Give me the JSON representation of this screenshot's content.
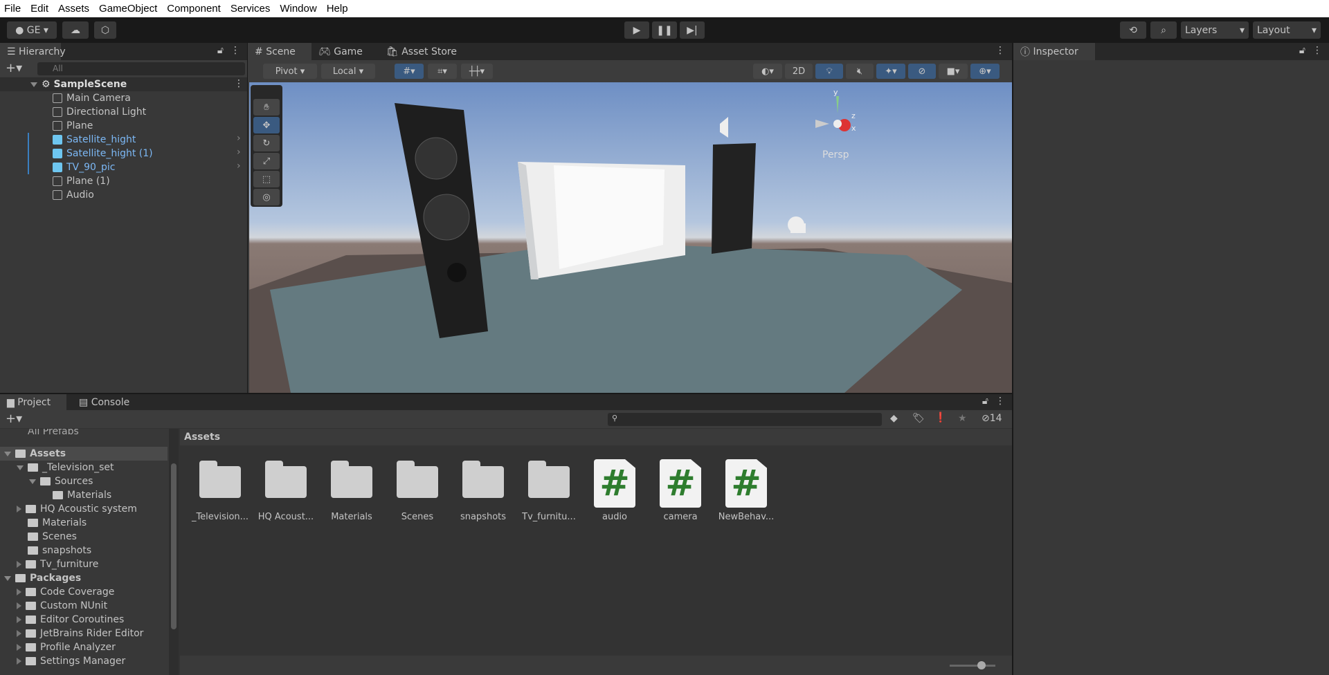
{
  "menu": [
    "File",
    "Edit",
    "Assets",
    "GameObject",
    "Component",
    "Services",
    "Window",
    "Help"
  ],
  "toolbar": {
    "account": "GE",
    "layers": "Layers",
    "layout": "Layout"
  },
  "hierarchy": {
    "title": "Hierarchy",
    "search_placeholder": "All",
    "scene": "SampleScene",
    "items": [
      {
        "label": "Main Camera",
        "prefab": false
      },
      {
        "label": "Directional Light",
        "prefab": false
      },
      {
        "label": "Plane",
        "prefab": false
      },
      {
        "label": "Satellite_hight",
        "prefab": true
      },
      {
        "label": "Satellite_hight (1)",
        "prefab": true
      },
      {
        "label": "TV_90_pic",
        "prefab": true
      },
      {
        "label": "Plane (1)",
        "prefab": false
      },
      {
        "label": "Audio",
        "prefab": false
      }
    ]
  },
  "scene": {
    "tabs": [
      "Scene",
      "Game",
      "Asset Store"
    ],
    "pivot": "Pivot",
    "local": "Local",
    "mode2d": "2D",
    "persp": "Persp",
    "gizmo_axes": {
      "y": "y",
      "z": "z",
      "x": "x"
    }
  },
  "inspector": {
    "title": "Inspector"
  },
  "project": {
    "tabs": [
      "Project",
      "Console"
    ],
    "hidden_count": "14",
    "breadcrumb": "Assets",
    "cut_item": "All Prefabs",
    "tree": [
      {
        "label": "Assets",
        "depth": 0,
        "bold": true,
        "open": true
      },
      {
        "label": "_Television_set",
        "depth": 1,
        "open": true
      },
      {
        "label": "Sources",
        "depth": 2,
        "open": true
      },
      {
        "label": "Materials",
        "depth": 3
      },
      {
        "label": "HQ Acoustic system",
        "depth": 1,
        "closed": true
      },
      {
        "label": "Materials",
        "depth": 1
      },
      {
        "label": "Scenes",
        "depth": 1
      },
      {
        "label": "snapshots",
        "depth": 1
      },
      {
        "label": "Tv_furniture",
        "depth": 1,
        "closed": true
      },
      {
        "label": "Packages",
        "depth": 0,
        "bold": true,
        "open": true
      },
      {
        "label": "Code Coverage",
        "depth": 1,
        "closed": true
      },
      {
        "label": "Custom NUnit",
        "depth": 1,
        "closed": true
      },
      {
        "label": "Editor Coroutines",
        "depth": 1,
        "closed": true
      },
      {
        "label": "JetBrains Rider Editor",
        "depth": 1,
        "closed": true
      },
      {
        "label": "Profile Analyzer",
        "depth": 1,
        "closed": true
      },
      {
        "label": "Settings Manager",
        "depth": 1,
        "closed": true
      }
    ],
    "assets": [
      {
        "label": "_Television...",
        "type": "folder"
      },
      {
        "label": "HQ Acoust...",
        "type": "folder"
      },
      {
        "label": "Materials",
        "type": "folder"
      },
      {
        "label": "Scenes",
        "type": "folder"
      },
      {
        "label": "snapshots",
        "type": "folder"
      },
      {
        "label": "Tv_furnitu...",
        "type": "folder"
      },
      {
        "label": "audio",
        "type": "script",
        "glyph": "#"
      },
      {
        "label": "camera",
        "type": "script",
        "glyph": "#"
      },
      {
        "label": "NewBehav...",
        "type": "script",
        "glyph": "#"
      }
    ],
    "icon_size_slider": 0.7
  }
}
